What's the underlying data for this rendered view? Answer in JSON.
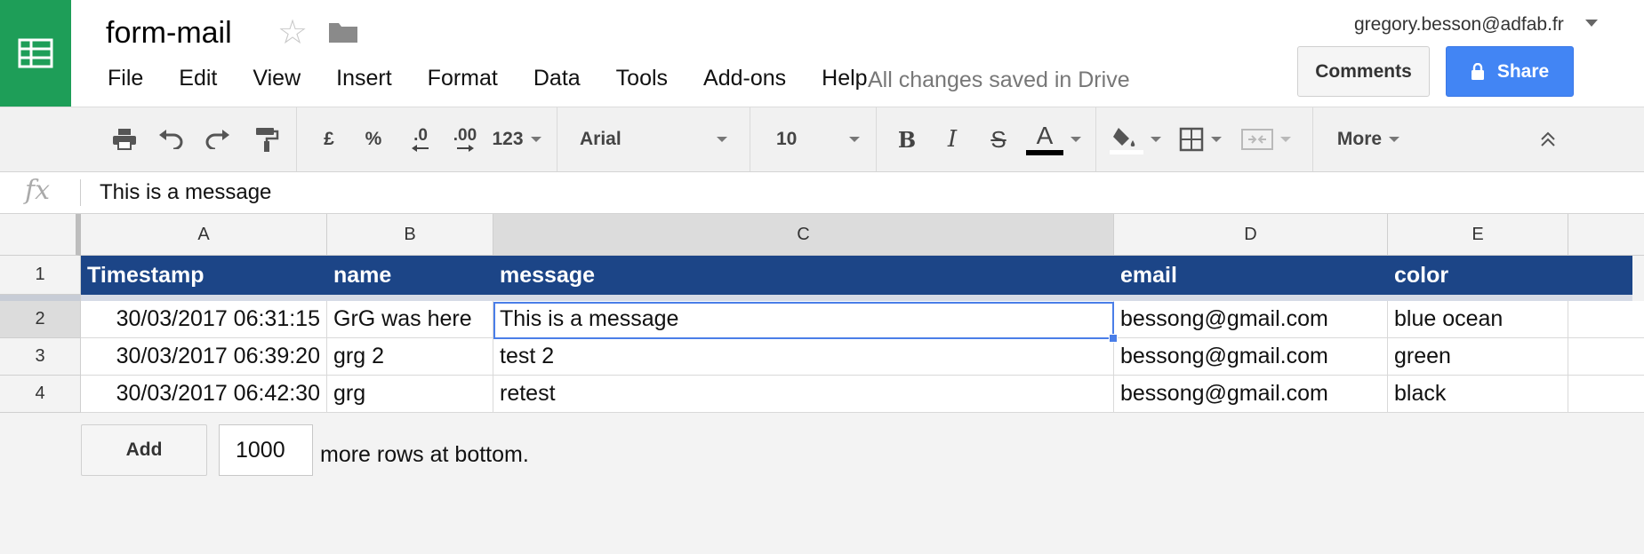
{
  "app": {
    "document_title": "form-mail",
    "save_status": "All changes saved in Drive",
    "user_email": "gregory.besson@adfab.fr",
    "comments_label": "Comments",
    "share_label": "Share",
    "brand_color": "#1e9e58",
    "share_color": "#4285f4"
  },
  "menu": [
    "File",
    "Edit",
    "View",
    "Insert",
    "Format",
    "Data",
    "Tools",
    "Add-ons",
    "Help"
  ],
  "toolbar": {
    "currency": "£",
    "percent": "%",
    "decrease_decimals": ".0",
    "increase_decimals": ".00",
    "number_format": "123",
    "font_family": "Arial",
    "font_size": "10",
    "bold": "B",
    "italic": "I",
    "strikethrough": "S",
    "text_color": "A",
    "more": "More",
    "icons": [
      "print-icon",
      "undo-icon",
      "redo-icon",
      "paint-format-icon",
      "fill-color-icon",
      "borders-icon",
      "merge-cells-icon",
      "collapse-toolbar-icon"
    ]
  },
  "formula_bar": {
    "fx": "fx",
    "value": "This is a message"
  },
  "sheet": {
    "columns": [
      "A",
      "B",
      "C",
      "D",
      "E"
    ],
    "selected_column": "C",
    "row_numbers": [
      "1",
      "2",
      "3",
      "4"
    ],
    "selected_row": "2",
    "header_row": [
      "Timestamp",
      "name",
      "message",
      "email",
      "color"
    ],
    "header_color": "#1c4587",
    "rows": [
      [
        "30/03/2017 06:31:15",
        "GrG was here",
        "This is a message",
        "bessong@gmail.com",
        "blue ocean"
      ],
      [
        "30/03/2017 06:39:20",
        "grg 2",
        "test 2",
        "bessong@gmail.com",
        "green"
      ],
      [
        "30/03/2017 06:42:30",
        "grg",
        "retest",
        "bessong@gmail.com",
        "black"
      ]
    ],
    "active_cell": "C2"
  },
  "add_rows": {
    "button_label": "Add",
    "count": "1000",
    "suffix": "more rows at bottom."
  }
}
